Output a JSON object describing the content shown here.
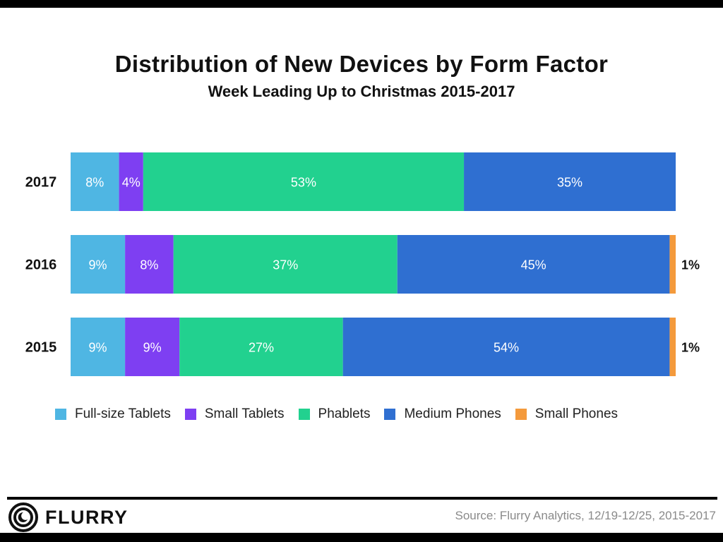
{
  "header": {
    "title": "Distribution of New Devices by Form Factor",
    "subtitle": "Week Leading Up to Christmas 2015-2017"
  },
  "chart_data": {
    "type": "bar",
    "orientation": "horizontal",
    "stacked": true,
    "title": "Distribution of New Devices by Form Factor",
    "subtitle": "Week Leading Up to Christmas 2015-2017",
    "xlabel": "",
    "ylabel": "",
    "xlim": [
      0,
      100
    ],
    "grid": false,
    "legend_position": "bottom",
    "categories": [
      "2017",
      "2016",
      "2015"
    ],
    "series": [
      {
        "name": "Full-size Tablets",
        "color": "#4FB6E3",
        "values": [
          8,
          9,
          9
        ],
        "labels": [
          "8%",
          "9%",
          "9%"
        ]
      },
      {
        "name": "Small Tablets",
        "color": "#7E3FF2",
        "values": [
          4,
          8,
          9
        ],
        "labels": [
          "4%",
          "8%",
          "9%"
        ]
      },
      {
        "name": "Phablets",
        "color": "#22D18F",
        "values": [
          53,
          37,
          27
        ],
        "labels": [
          "53%",
          "37%",
          "27%"
        ]
      },
      {
        "name": "Medium Phones",
        "color": "#2F6FD1",
        "values": [
          35,
          45,
          54
        ],
        "labels": [
          "35%",
          "45%",
          "54%"
        ]
      },
      {
        "name": "Small Phones",
        "color": "#F49A3C",
        "values": [
          0,
          1,
          1
        ],
        "labels": [
          "",
          "1%",
          "1%"
        ]
      }
    ]
  },
  "footer": {
    "logo_text": "FLURRY",
    "source": "Source: Flurry Analytics, 12/19-12/25, 2015-2017"
  }
}
